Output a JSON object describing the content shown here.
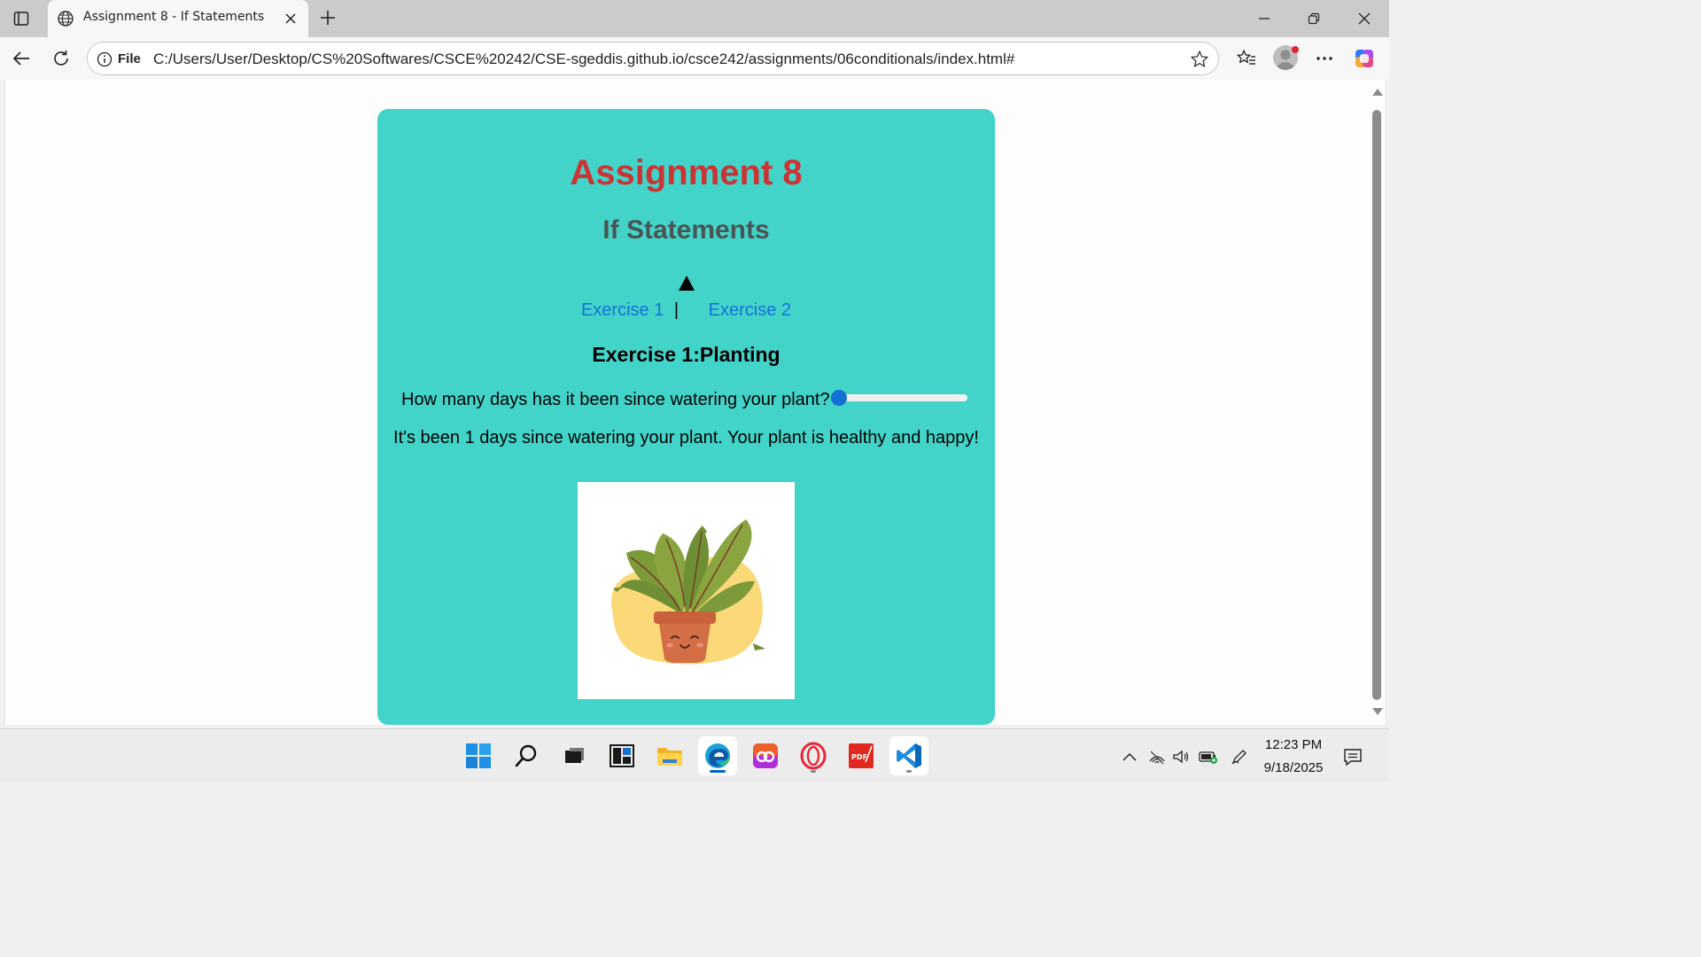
{
  "browser": {
    "tab_title": "Assignment 8 - If Statements",
    "omnibox_scheme": "File",
    "url": "C:/Users/User/Desktop/CS%20Softwares/CSCE%20242/CSE-sgeddis.github.io/csce242/assignments/06conditionals/index.html#"
  },
  "page": {
    "title": "Assignment 8",
    "subtitle": "If Statements",
    "toggle_icon": "triangle-up-icon",
    "nav": {
      "exercise1": "Exercise 1",
      "separator": "|",
      "exercise2": "Exercise 2"
    },
    "exercise_heading": "Exercise 1:Planting",
    "question": "How many days has it been since watering your plant?",
    "slider": {
      "value": 1,
      "min": 1,
      "max": 12
    },
    "result": "It's been 1 days since watering your plant. Your plant is healthy and happy!",
    "image_icon": "happy-plant-image"
  },
  "taskbar": {
    "time": "12:23 PM",
    "date": "9/18/2025"
  },
  "colors": {
    "card_bg": "#42d4c9",
    "title": "#cc3333",
    "subtitle": "#4a5454",
    "link": "#1570d6",
    "slider": "#1570d6"
  }
}
